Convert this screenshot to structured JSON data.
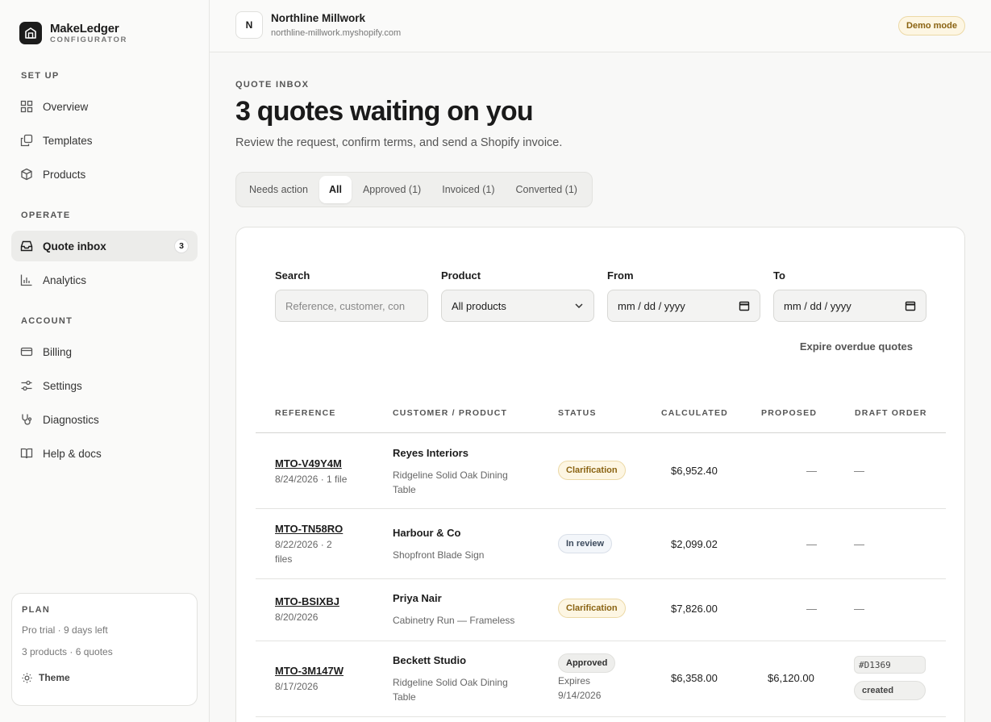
{
  "brand": {
    "name": "MakeLedger",
    "subtitle": "CONFIGURATOR"
  },
  "sidebar": {
    "sections": [
      {
        "label": "SET UP"
      },
      {
        "label": "OPERATE"
      },
      {
        "label": "ACCOUNT"
      }
    ],
    "items": [
      {
        "label": "Overview",
        "icon": "grid-icon"
      },
      {
        "label": "Templates",
        "icon": "copy-icon"
      },
      {
        "label": "Products",
        "icon": "package-icon"
      },
      {
        "label": "Quote inbox",
        "icon": "inbox-icon",
        "count": "3",
        "active": true
      },
      {
        "label": "Analytics",
        "icon": "bar-chart-icon"
      },
      {
        "label": "Billing",
        "icon": "credit-card-icon"
      },
      {
        "label": "Settings",
        "icon": "sliders-icon"
      },
      {
        "label": "Diagnostics",
        "icon": "stethoscope-icon"
      },
      {
        "label": "Help & docs",
        "icon": "book-icon"
      }
    ],
    "plan": {
      "label": "PLAN",
      "trial": "Pro trial · 9 days left",
      "usage": "3 products · 6 quotes",
      "theme_label": "Theme"
    }
  },
  "topbar": {
    "avatar_letter": "N",
    "store_name": "Northline Millwork",
    "store_domain": "northline-millwork.myshopify.com",
    "demo_badge": "Demo mode"
  },
  "main": {
    "eyebrow": "QUOTE INBOX",
    "title": "3 quotes waiting on you",
    "subtitle": "Review the request, confirm terms, and send a Shopify invoice.",
    "tabs": [
      {
        "label": "Needs action"
      },
      {
        "label": "All",
        "active": true
      },
      {
        "label": "Approved (1)"
      },
      {
        "label": "Invoiced (1)"
      },
      {
        "label": "Converted (1)"
      }
    ],
    "filters": {
      "search_label": "Search",
      "search_placeholder": "Reference, customer, con",
      "product_label": "Product",
      "product_value": "All products",
      "from_label": "From",
      "from_value": "mm / dd / yyyy",
      "to_label": "To",
      "to_value": "mm / dd / yyyy",
      "expire_label": "Expire overdue quotes"
    },
    "table": {
      "headers": [
        "REFERENCE",
        "CUSTOMER / PRODUCT",
        "STATUS",
        "CALCULATED",
        "PROPOSED",
        "DRAFT ORDER"
      ],
      "rows": [
        {
          "ref": "MTO-V49Y4M",
          "meta": "8/24/2026 · 1 file",
          "customer": "Reyes Interiors",
          "product": "Ridgeline Solid Oak Dining Table",
          "status": "Clarification",
          "calculated": "$6,952.40",
          "proposed": "—",
          "draft": "—"
        },
        {
          "ref": "MTO-TN58RO",
          "meta": "8/22/2026 · 2 files",
          "customer": "Harbour & Co",
          "product": "Shopfront Blade Sign",
          "status": "In review",
          "calculated": "$2,099.02",
          "proposed": "—",
          "draft": "—"
        },
        {
          "ref": "MTO-BSIXBJ",
          "meta": "8/20/2026",
          "customer": "Priya Nair",
          "product": "Cabinetry Run — Frameless",
          "status": "Clarification",
          "calculated": "$7,826.00",
          "proposed": "—",
          "draft": "—"
        },
        {
          "ref": "MTO-3M147W",
          "meta": "8/17/2026",
          "customer": "Beckett Studio",
          "product": "Ridgeline Solid Oak Dining Table",
          "status": "Approved",
          "expires": "Expires 9/14/2026",
          "calculated": "$6,358.00",
          "proposed": "$6,120.00",
          "draft_id": "#D1369",
          "draft_status": "created"
        }
      ]
    }
  }
}
